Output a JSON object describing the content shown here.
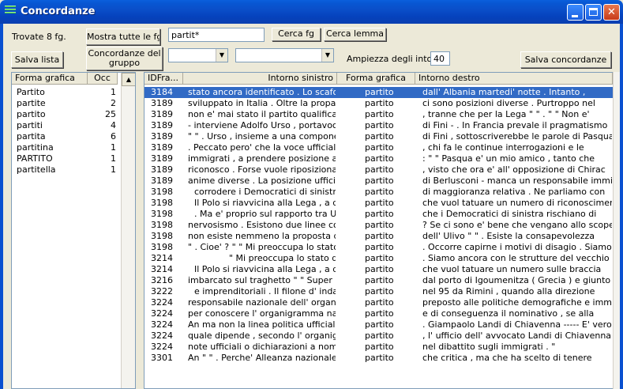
{
  "window": {
    "title": "Concordanze"
  },
  "toolbar": {
    "found_label": "Trovate 8 fg.",
    "show_all_button": "Mostra tutte le fg",
    "search_value": "partit*",
    "search_fg_button": "Cerca fg",
    "search_lemma_button": "Cerca lemma",
    "save_list_button": "Salva lista",
    "group_concord_button": "Concordanze del gruppo",
    "combo1_value": "",
    "combo2_value": "",
    "context_label": "Ampiezza degli intorni",
    "context_value": "40",
    "save_concord_button": "Salva concordanze"
  },
  "left_table": {
    "headers": [
      "Forma grafica",
      "Occ"
    ],
    "rows": [
      {
        "form": "Partito",
        "occ": "1"
      },
      {
        "form": "partite",
        "occ": "2"
      },
      {
        "form": "partito",
        "occ": "25"
      },
      {
        "form": "partiti",
        "occ": "4"
      },
      {
        "form": "partita",
        "occ": "6"
      },
      {
        "form": "partitina",
        "occ": "1"
      },
      {
        "form": "PARTITO",
        "occ": "1"
      },
      {
        "form": "partitella",
        "occ": "1"
      }
    ]
  },
  "right_table": {
    "headers": [
      "IDFra...",
      "Intorno sinistro",
      "Forma grafica",
      "Intorno destro"
    ],
    "rows": [
      {
        "id": "3184",
        "left": "stato ancora identificato . Lo scafo e...",
        "form": "partito",
        "right": "dall' Albania martedi' notte . Intanto ,",
        "selected": true
      },
      {
        "id": "3189",
        "left": "sviluppato in Italia . Oltre la propaga...",
        "form": "partito",
        "right": "ci sono posizioni diverse . Purtroppo nel"
      },
      {
        "id": "3189",
        "left": "non e' mai stato il partito qualificante ...",
        "form": "partito",
        "right": ", tranne che per la Lega \" \" . \" \" Non e'"
      },
      {
        "id": "3189",
        "left": "- interviene Adolfo Urso , portavoce ...",
        "form": "partito",
        "right": "di Fini - . In Francia prevale il pragmatismo"
      },
      {
        "id": "3189",
        "left": "\" \" . Urso , insieme a una componen...",
        "form": "partito",
        "right": "di Fini , sottoscriverebbe le parole di Pasqua"
      },
      {
        "id": "3189",
        "left": ". Peccato pero' che la voce ufficiale...",
        "form": "partito",
        "right": ", chi fa le continue interrogazioni e le"
      },
      {
        "id": "3189",
        "left": "immigrati , a prendere posizione a no...",
        "form": "partito",
        "right": ": \" \" Pasqua e' un mio amico , tanto che"
      },
      {
        "id": "3189",
        "left": "riconosco . Forse vuole riposizionarsi...",
        "form": "partito",
        "right": ", visto che ora e' all' opposizione di Chirac"
      },
      {
        "id": "3189",
        "left": "anime diverse . La posizione ufficiale...",
        "form": "partito",
        "right": "di Berlusconi - manca un responsabile immigrazione"
      },
      {
        "id": "3198",
        "left": "corrodere i Democratici di sinistra , il",
        "form": "partito",
        "right": "di maggioranza relativa . Ne parliamo con",
        "indent": true
      },
      {
        "id": "3198",
        "left": "Il Polo si riavvicina alla Lega , a quel",
        "form": "partito",
        "right": "che vuol tatuare un numero di riconoscimento",
        "indent": true
      },
      {
        "id": "3198",
        "left": ". Ma e' proprio sul rapporto tra Ulivo e",
        "form": "partito",
        "right": "che i Democratici di sinistra rischiano di",
        "indent": true
      },
      {
        "id": "3198",
        "left": "nervosismo . Esistono due linee cont...",
        "form": "partito",
        "right": "? Se ci sono e' bene che vengano allo scoperto"
      },
      {
        "id": "3198",
        "left": "non esiste nemmeno la proposta di u...",
        "form": "partito",
        "right": "dell' Ulivo \" \" . Esiste la consapevolezza"
      },
      {
        "id": "3198",
        "left": "\" . Cioe' ? \" \" Mi preoccupa lo stato ...",
        "form": "partito",
        "right": ". Occorre capirne i motivi di disagio . Siamo"
      },
      {
        "id": "3214",
        "left": "\" Mi preoccupa lo stato del",
        "form": "partito",
        "right": ". Siamo ancora con le strutture del vecchio",
        "indent2": true
      },
      {
        "id": "3214",
        "left": "Il Polo si riavvicina alla Lega , a quel",
        "form": "partito",
        "right": "che vuol tatuare un numero sulle braccia",
        "indent": true
      },
      {
        "id": "3216",
        "left": "imbarcato sul traghetto \" \" Super Fa...",
        "form": "partito",
        "right": "dal porto di Igoumenitza ( Grecia ) e giunto"
      },
      {
        "id": "3222",
        "left": "e imprenditoriali . Il filone d' indagine",
        "form": "partito",
        "right": "nel 95 da Rimini , quando alla direzione",
        "indent": true
      },
      {
        "id": "3224",
        "left": "responsabile nazionale dell' organo ...",
        "form": "partito",
        "right": "preposto alle politiche demografiche e immigratorie"
      },
      {
        "id": "3224",
        "left": "per conoscere l' organigramma nazio...",
        "form": "partito",
        "right": "e di conseguenza il nominativo , se alla"
      },
      {
        "id": "3224",
        "left": "An ma non la linea politica ufficiale d...",
        "form": "partito",
        "right": ". Giampaolo Landi di Chiavenna ----- E' vero"
      },
      {
        "id": "3224",
        "left": "quale dipende , secondo l' organigra...",
        "form": "partito",
        "right": ", l' ufficio dell' avvocato Landi di Chiavenna"
      },
      {
        "id": "3224",
        "left": "note ufficiali o dichiarazioni a nome ...",
        "form": "partito",
        "right": "nel dibattito sugli immigrati . \""
      },
      {
        "id": "3301",
        "left": "An \" \" . Perche' Alleanza nazionale",
        "form": "partito",
        "right": "che critica , ma che ha scelto di tenere"
      }
    ]
  }
}
